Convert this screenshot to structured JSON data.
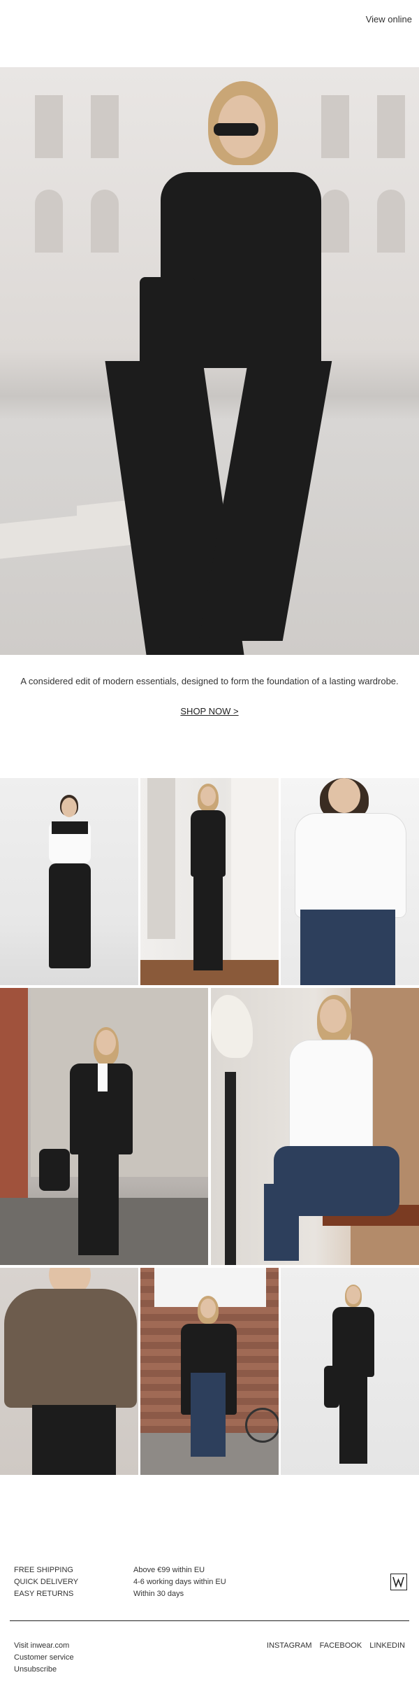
{
  "header": {
    "view_online": "View online"
  },
  "hero": {
    "text": "A considered edit of modern essentials, designed to form the foundation of a lasting wardrobe.",
    "cta": "SHOP NOW >"
  },
  "footer": {
    "benefits": [
      "FREE SHIPPING",
      "QUICK DELIVERY",
      "EASY RETURNS"
    ],
    "benefit_details": [
      "Above €99 within EU",
      "4-6 working days within EU",
      "Within 30 days"
    ],
    "links": [
      "Visit inwear.com",
      "Customer service",
      "Unsubscribe"
    ],
    "social": [
      "INSTAGRAM",
      "FACEBOOK",
      "LINKEDIN"
    ],
    "logo_icon": "inwear-logo-icon"
  },
  "colors": {
    "text": "#222222",
    "background": "#ffffff"
  }
}
